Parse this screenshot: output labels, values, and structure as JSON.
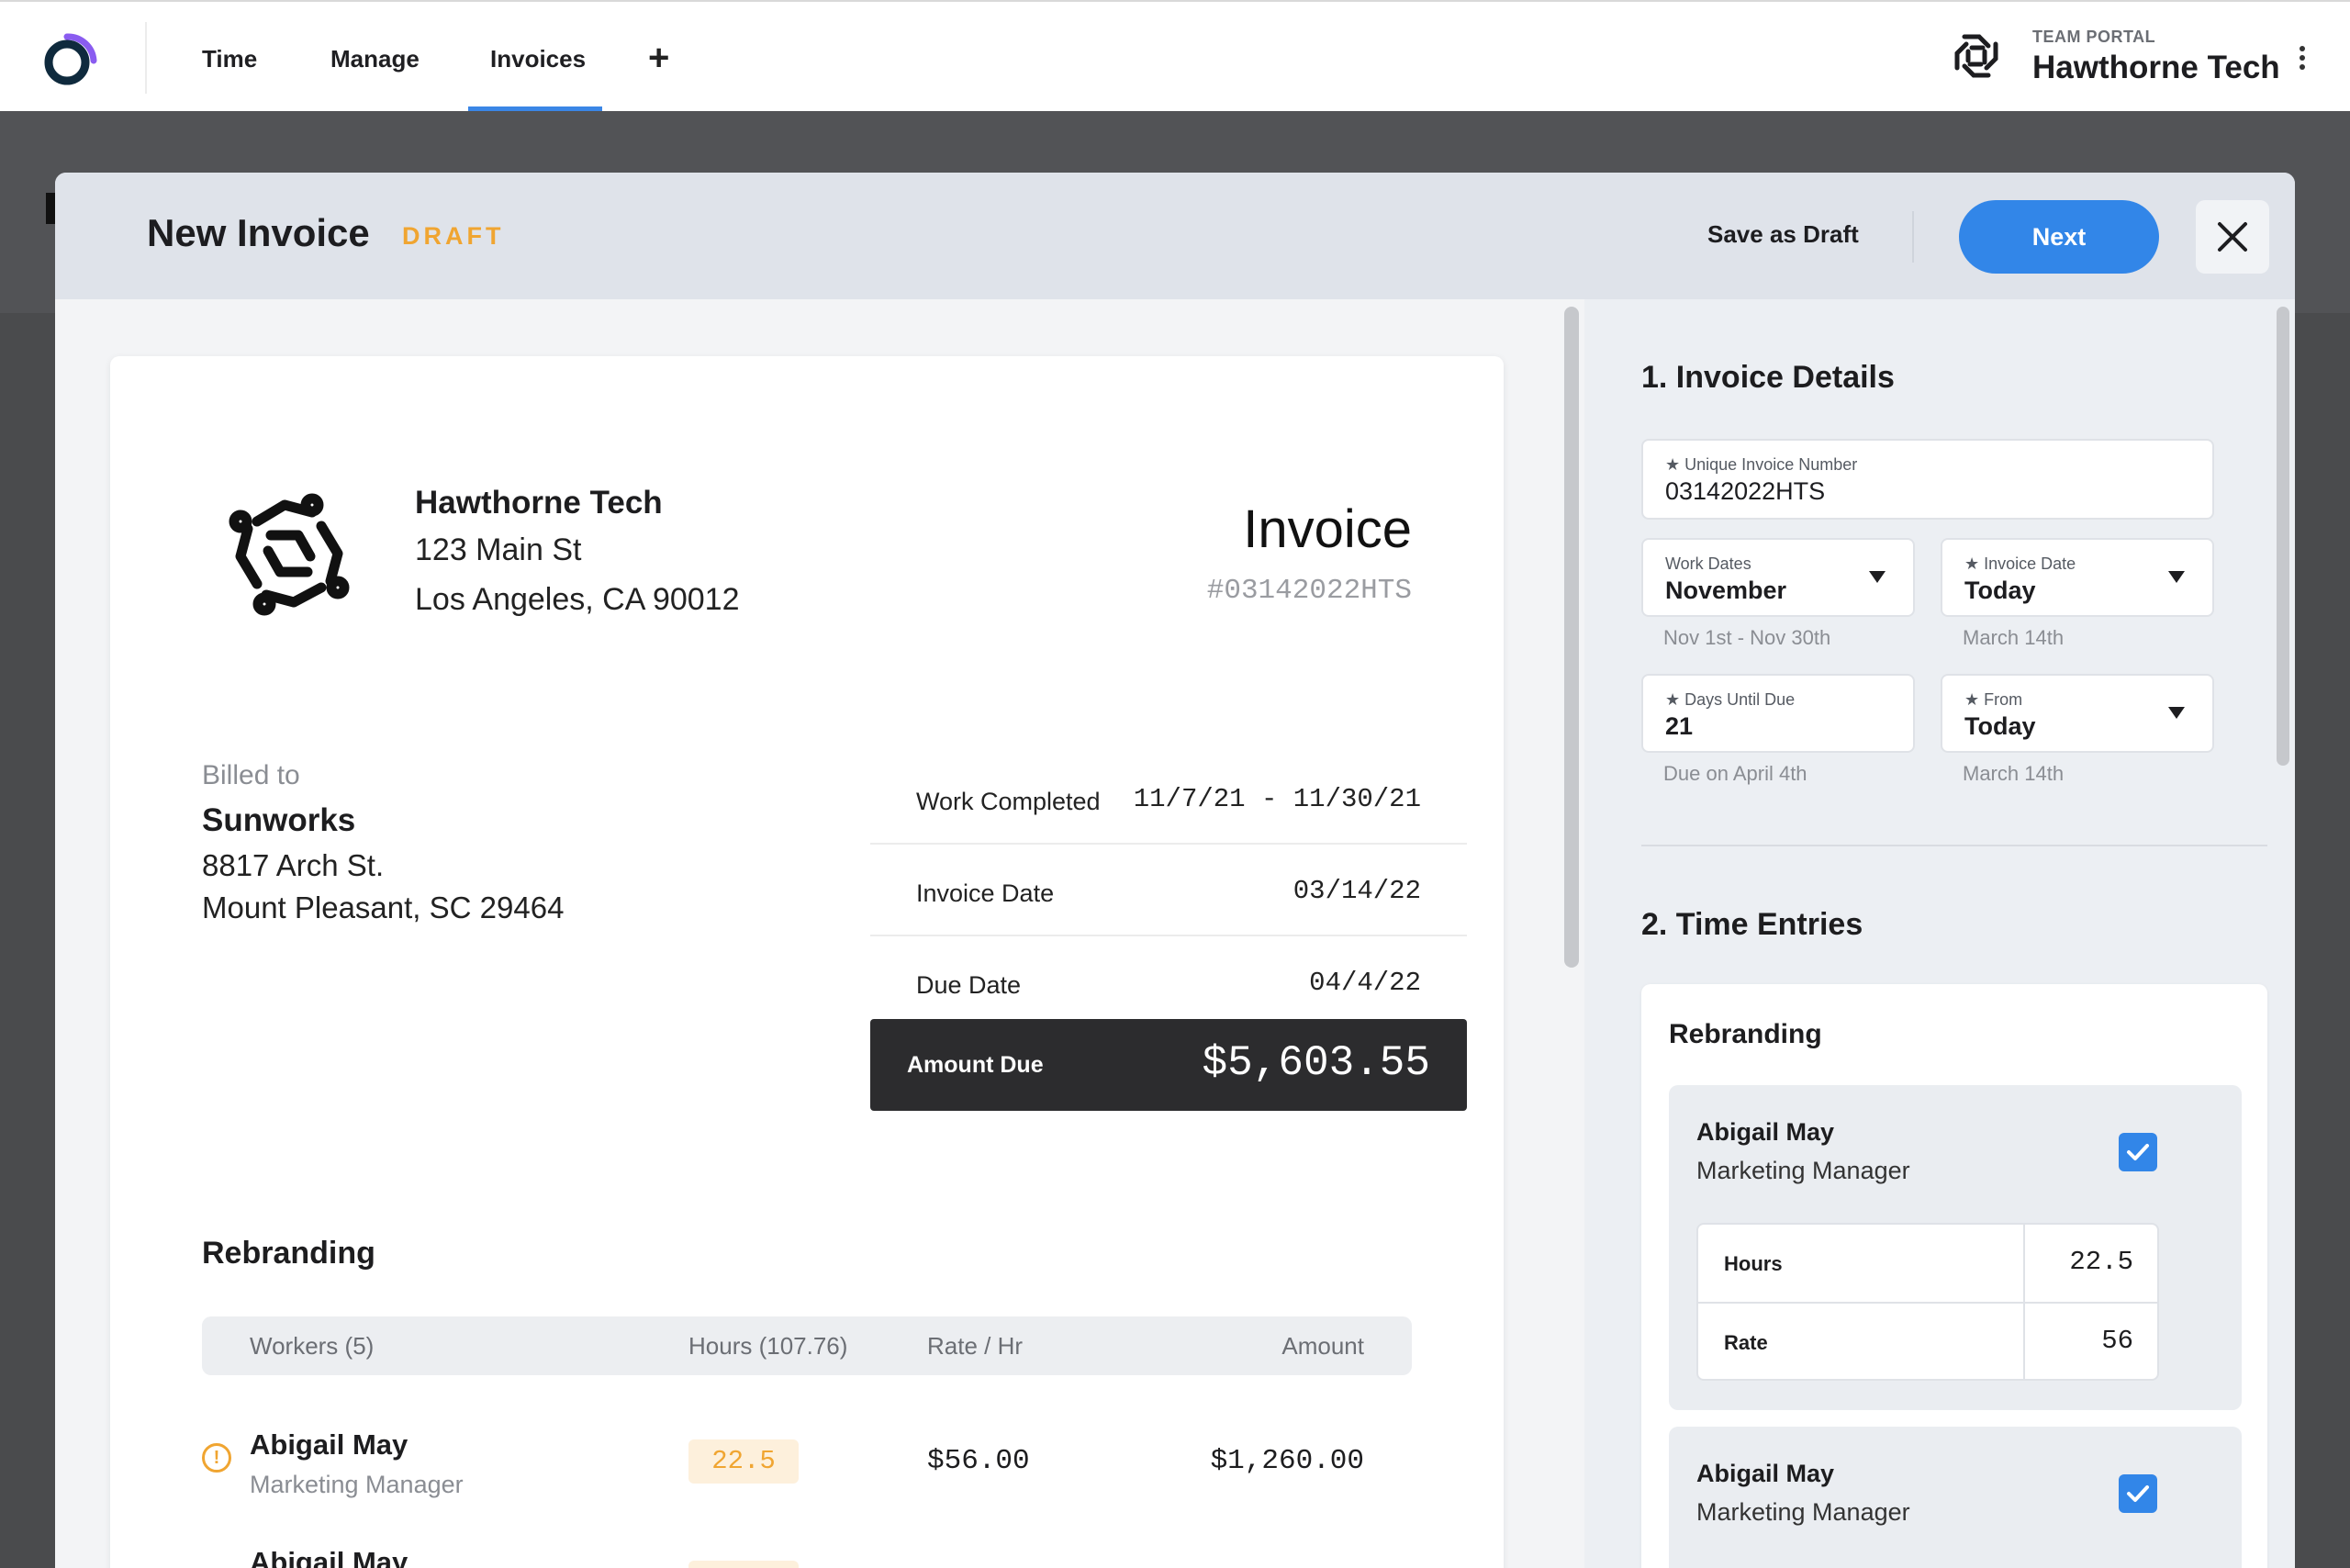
{
  "nav": {
    "tabs": [
      {
        "label": "Time"
      },
      {
        "label": "Manage"
      },
      {
        "label": "Invoices",
        "active": true
      }
    ],
    "add_icon": "plus-icon",
    "portal_label": "TEAM PORTAL",
    "portal_name": "Hawthorne Tech",
    "menu_icon": "kebab-menu-icon"
  },
  "modal": {
    "title": "New Invoice",
    "status_badge": "DRAFT",
    "save_draft_label": "Save as Draft",
    "next_label": "Next",
    "close_icon": "close-icon"
  },
  "preview": {
    "company": "Hawthorne Tech",
    "address_line1": "123 Main St",
    "address_line2": "Los Angeles, CA 90012",
    "invoice_word": "Invoice",
    "invoice_number": "#03142022HTS",
    "billed_to_label": "Billed to",
    "client_name": "Sunworks",
    "client_line1": "8817 Arch St.",
    "client_line2": "Mount Pleasant, SC 29464",
    "summary": [
      {
        "label": "Work Completed",
        "value": "11/7/21 - 11/30/21"
      },
      {
        "label": "Invoice Date",
        "value": "03/14/22"
      },
      {
        "label": "Due Date",
        "value": "04/4/22"
      }
    ],
    "amount_due_label": "Amount Due",
    "amount_due_value": "$5,603.55",
    "section_title": "Rebranding",
    "table_headers": {
      "workers": "Workers (5)",
      "hours": "Hours (107.76)",
      "rate": "Rate / Hr",
      "amount": "Amount"
    },
    "rows": [
      {
        "name": "Abigail May",
        "role": "Marketing Manager",
        "hours": "22.5",
        "rate": "$56.00",
        "amount": "$1,260.00",
        "warning": true
      },
      {
        "name": "Abigail May"
      }
    ]
  },
  "form": {
    "section1_title": "1. Invoice Details",
    "invoice_number_label": "★ Unique Invoice Number",
    "invoice_number_value": "03142022HTS",
    "work_dates_label": "Work Dates",
    "work_dates_value": "November",
    "work_dates_hint": "Nov 1st - Nov 30th",
    "invoice_date_label": "★ Invoice Date",
    "invoice_date_value": "Today",
    "invoice_date_hint": "March 14th",
    "days_due_label": "★ Days Until Due",
    "days_due_value": "21",
    "days_due_hint": "Due on April 4th",
    "from_label": "★ From",
    "from_value": "Today",
    "from_hint": "March 14th",
    "section2_title": "2. Time Entries",
    "project_title": "Rebranding",
    "entries": [
      {
        "name": "Abigail May",
        "role": "Marketing Manager",
        "checked": true,
        "hours_label": "Hours",
        "hours": "22.5",
        "rate_label": "Rate",
        "rate": "56"
      },
      {
        "name": "Abigail May",
        "role": "Marketing Manager",
        "checked": true
      }
    ]
  },
  "colors": {
    "accent": "#3286e8",
    "warning": "#f0a531",
    "dark": "#2c2c2e"
  }
}
